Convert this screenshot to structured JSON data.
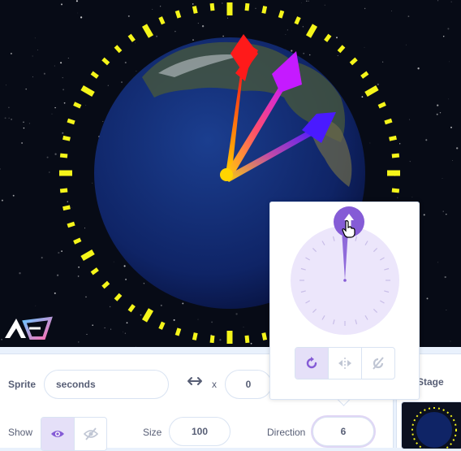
{
  "stage": {
    "description_icons": [
      "earth-globe",
      "clock-hands"
    ]
  },
  "sprite_info": {
    "sprite_label": "Sprite",
    "sprite_name": "seconds",
    "x_label": "x",
    "x_value": "0",
    "show_label": "Show",
    "size_label": "Size",
    "size_value": "100",
    "direction_label": "Direction",
    "direction_value": "6"
  },
  "stage_pane": {
    "title": "Stage"
  },
  "direction_popover": {
    "dial_direction_deg": 6,
    "rotation_styles": [
      "all-around",
      "left-right",
      "dont-rotate"
    ],
    "selected_style": "all-around"
  },
  "colors": {
    "accent": "#855cd6",
    "accent_light": "#e5e0f8",
    "panel_bg": "#e9f1fc",
    "text": "#575e75",
    "tick_yellow": "#f5f51a"
  }
}
